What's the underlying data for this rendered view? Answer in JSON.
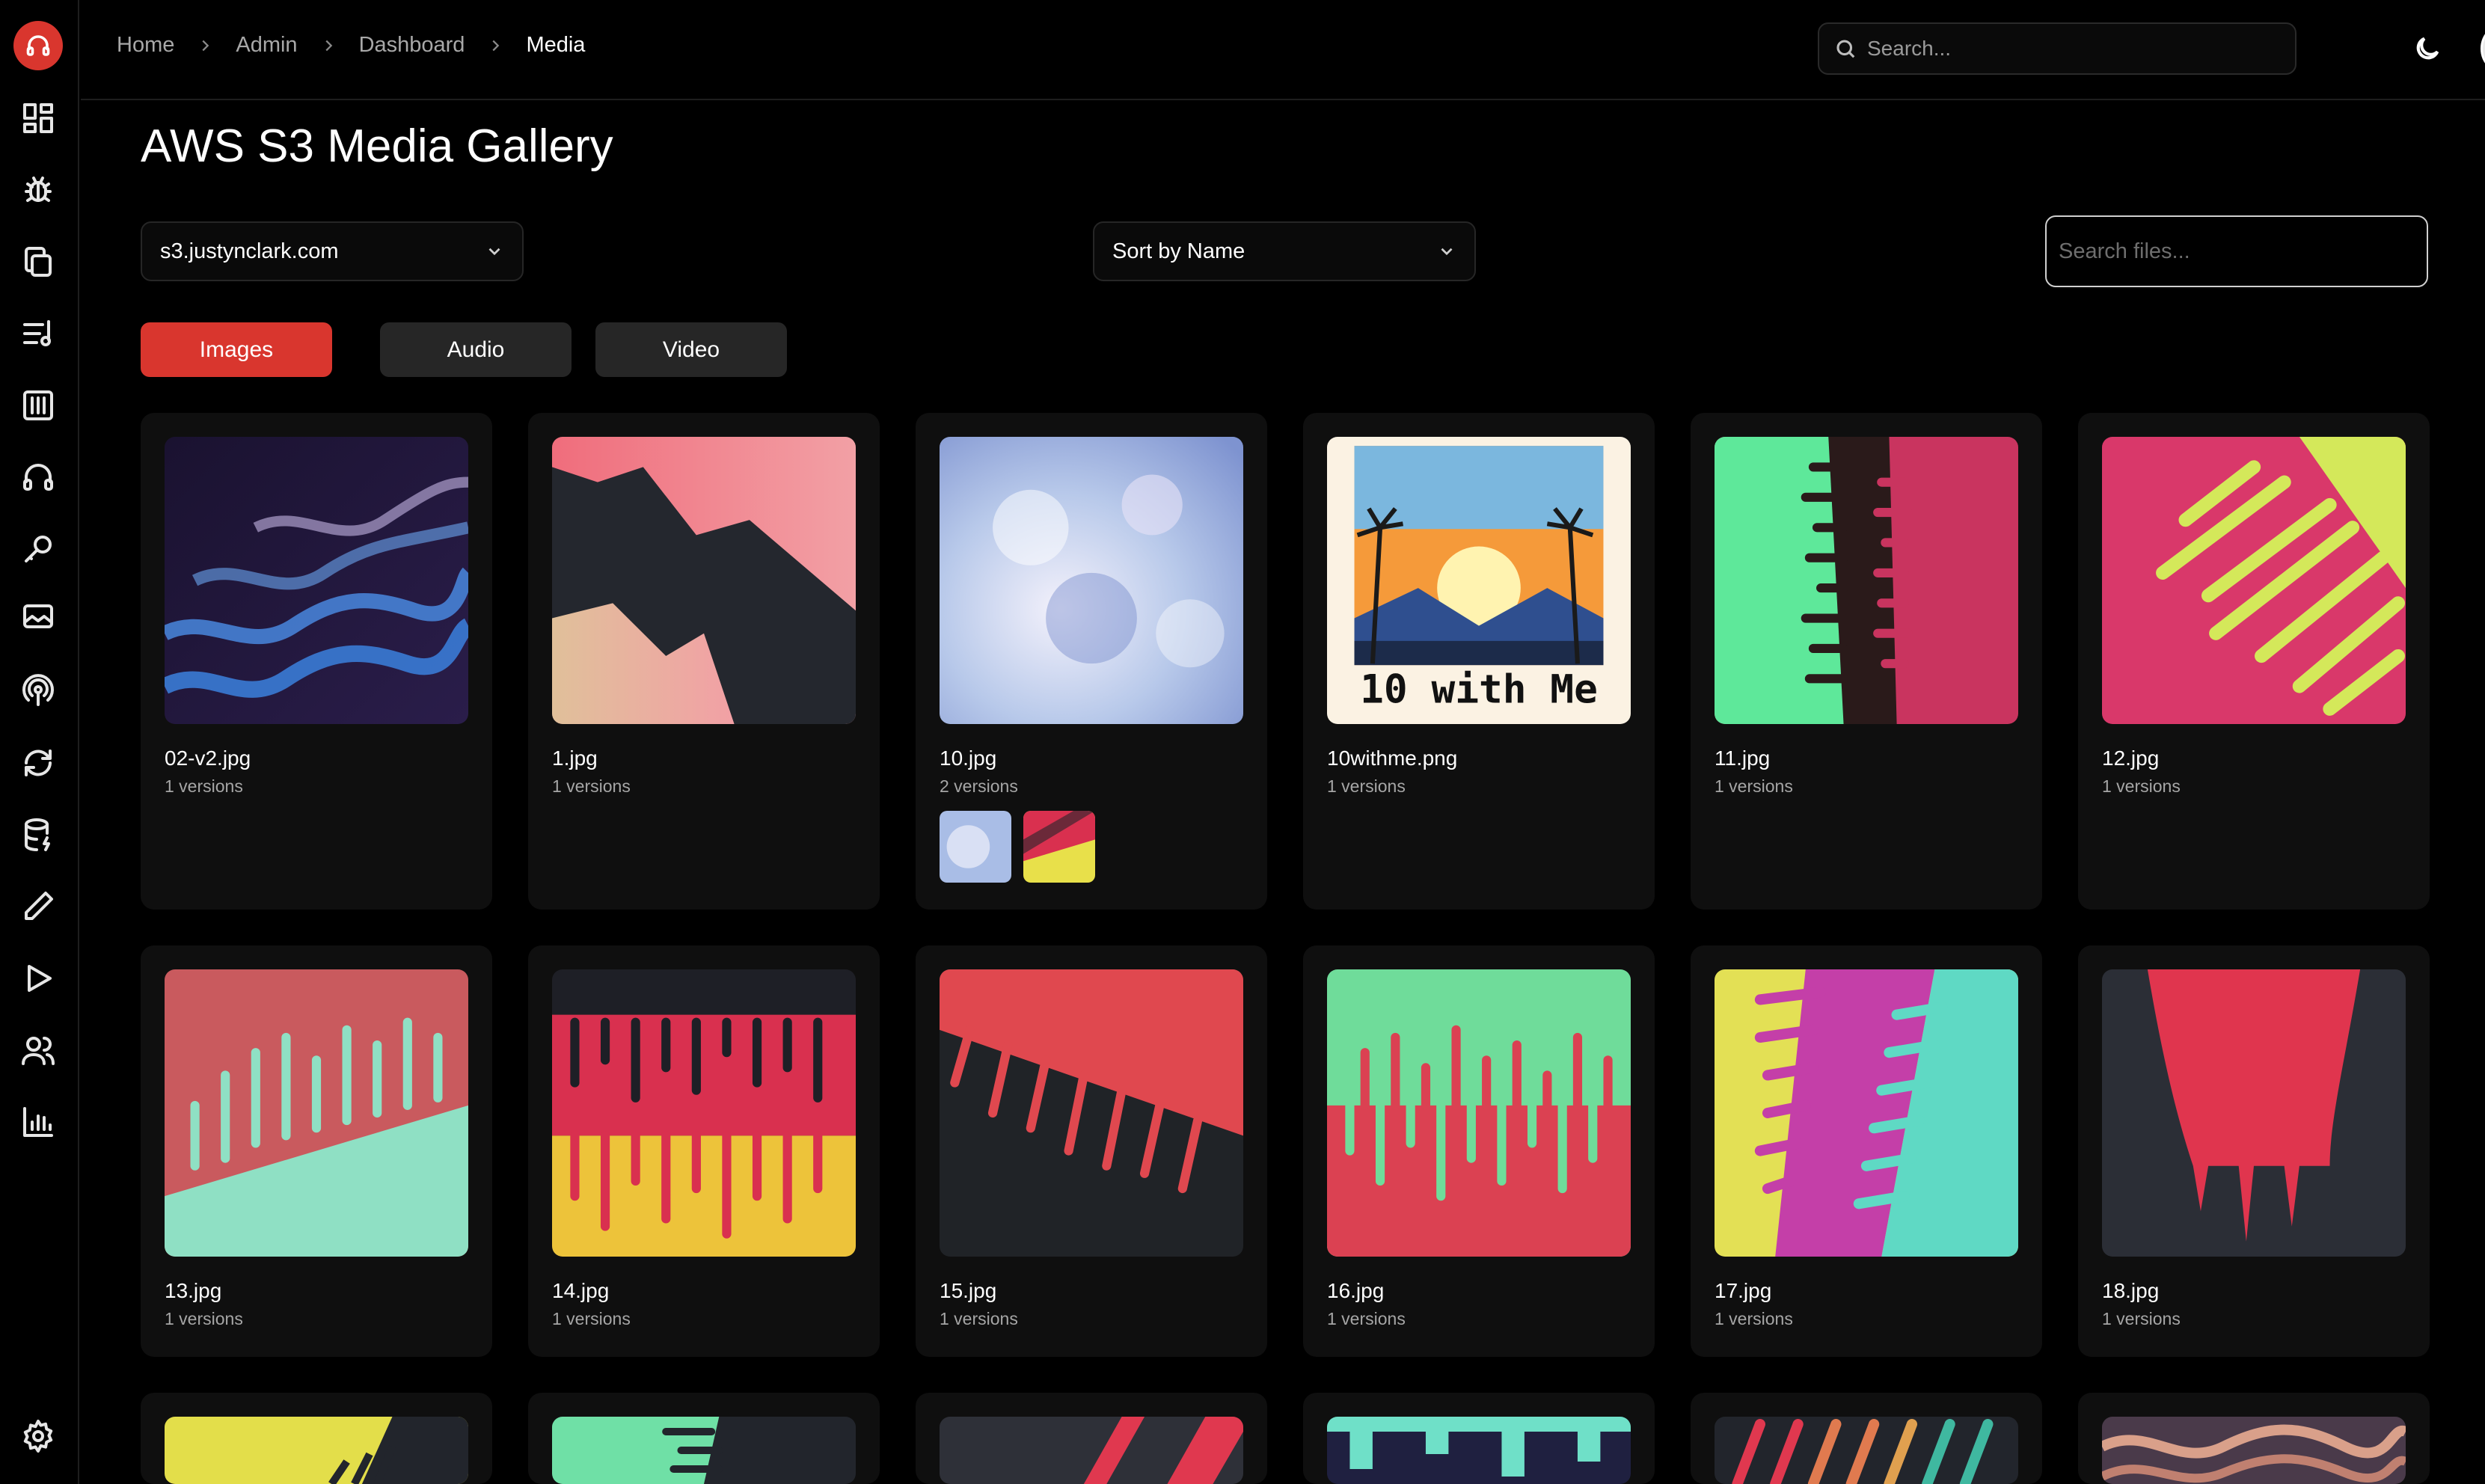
{
  "breadcrumb": [
    "Home",
    "Admin",
    "Dashboard",
    "Media"
  ],
  "header": {
    "search_placeholder": "Search..."
  },
  "page": {
    "title": "AWS S3 Media Gallery"
  },
  "controls": {
    "bucket": "s3.justynclark.com",
    "sort": "Sort by Name",
    "file_search_placeholder": "Search files..."
  },
  "tabs": [
    {
      "label": "Images",
      "active": true
    },
    {
      "label": "Audio",
      "active": false
    },
    {
      "label": "Video",
      "active": false
    }
  ],
  "sidebar": {
    "icons": [
      "layout-grid-icon",
      "bug-icon",
      "copy-icon",
      "music-list-icon",
      "library-icon",
      "headphones-icon",
      "microphone-icon",
      "image-icon",
      "podcast-icon",
      "refresh-icon",
      "database-icon",
      "pencil-icon",
      "play-icon",
      "users-icon",
      "bar-chart-icon"
    ],
    "settings_icon": "gear-icon",
    "accent": "#d9362e"
  },
  "media": [
    {
      "name": "02-v2.jpg",
      "versions": "1 versions"
    },
    {
      "name": "1.jpg",
      "versions": "1 versions"
    },
    {
      "name": "10.jpg",
      "versions": "2 versions"
    },
    {
      "name": "10withme.png",
      "versions": "1 versions",
      "image_text": "10 with Me"
    },
    {
      "name": "11.jpg",
      "versions": "1 versions"
    },
    {
      "name": "12.jpg",
      "versions": "1 versions"
    },
    {
      "name": "13.jpg",
      "versions": "1 versions"
    },
    {
      "name": "14.jpg",
      "versions": "1 versions"
    },
    {
      "name": "15.jpg",
      "versions": "1 versions"
    },
    {
      "name": "16.jpg",
      "versions": "1 versions"
    },
    {
      "name": "17.jpg",
      "versions": "1 versions"
    },
    {
      "name": "18.jpg",
      "versions": "1 versions"
    }
  ]
}
